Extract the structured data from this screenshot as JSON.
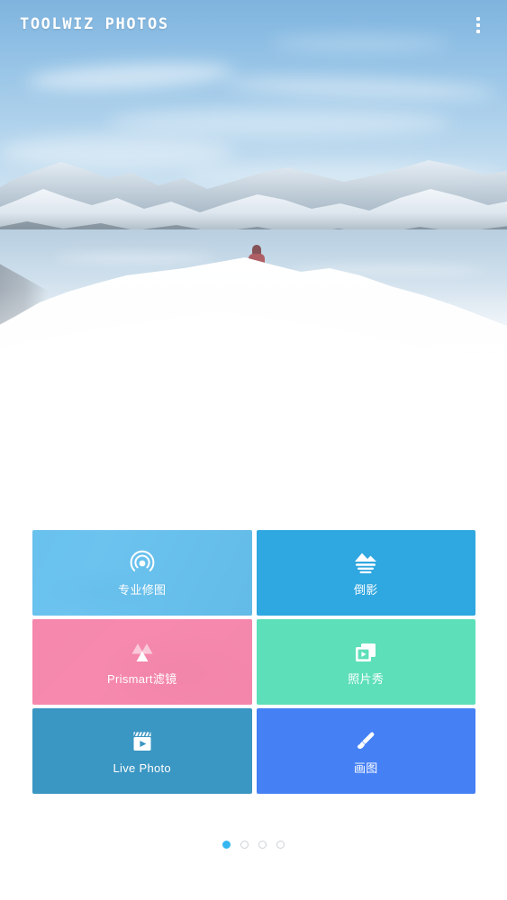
{
  "header": {
    "title": "TOOLWIZ PHOTOS",
    "overflow_menu_icon": "more-vert-icon",
    "title_color": "#ffffff"
  },
  "hero": {
    "description": "Snowy mountain range reflected in a lake with a person in a red jacket standing on a snow hill",
    "sky_color": "#8dbee4",
    "snow_color": "#ffffff"
  },
  "tiles": [
    {
      "label": "专业修图",
      "icon": "lens-focus-icon",
      "color": "#4cb8ee",
      "has_photo_background": true
    },
    {
      "label": "倒影",
      "icon": "mountain-reflection-icon",
      "color": "#2fa7e0",
      "has_photo_background": false
    },
    {
      "label": "Prismart滤镜",
      "icon": "prism-triangles-icon",
      "color": "#f77ca6",
      "has_photo_background": true
    },
    {
      "label": "照片秀",
      "icon": "slideshow-play-icon",
      "color": "#5ddfb9",
      "has_photo_background": false
    },
    {
      "label": "Live Photo",
      "icon": "clapperboard-icon",
      "color": "#3a96c2",
      "has_photo_background": false
    },
    {
      "label": "画图",
      "icon": "paintbrush-icon",
      "color": "#4580f5",
      "has_photo_background": false
    }
  ],
  "pagination": {
    "total": 4,
    "active_index": 0,
    "active_color": "#35b6f0",
    "inactive_color": "#ccd2d6"
  }
}
